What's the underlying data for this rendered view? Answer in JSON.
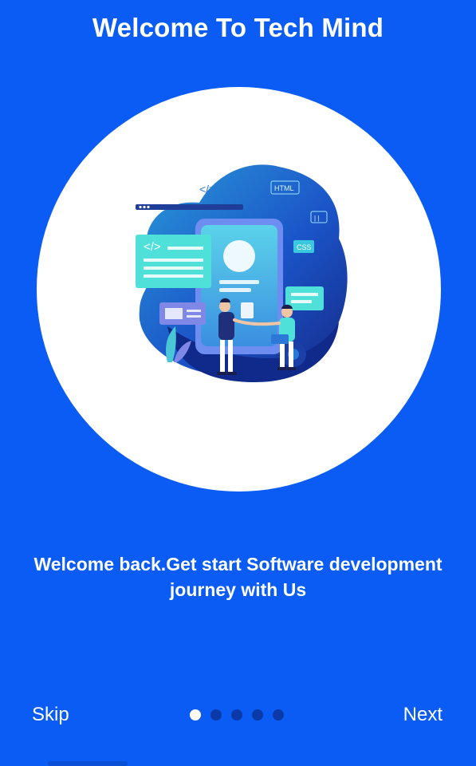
{
  "header": {
    "title": "Welcome To Tech Mind"
  },
  "illustration": {
    "tags": {
      "code_top": "</>",
      "code_card": "</>",
      "html": "HTML",
      "css": "CSS",
      "pause": "| |"
    }
  },
  "body": {
    "subtitle_line1": "Welcome back.Get start Software development",
    "subtitle_line2": "journey with Us"
  },
  "footer": {
    "skip_label": "Skip",
    "next_label": "Next",
    "pagination": {
      "current": 1,
      "total": 5
    }
  },
  "colors": {
    "background": "#0a5cf5",
    "text": "#ffffff",
    "dot_inactive": "#0b3aa8",
    "dot_active": "#ffffff",
    "illustration_dark": "#0f2a8a",
    "illustration_mid": "#1f67d6",
    "illustration_light": "#37d2de"
  }
}
